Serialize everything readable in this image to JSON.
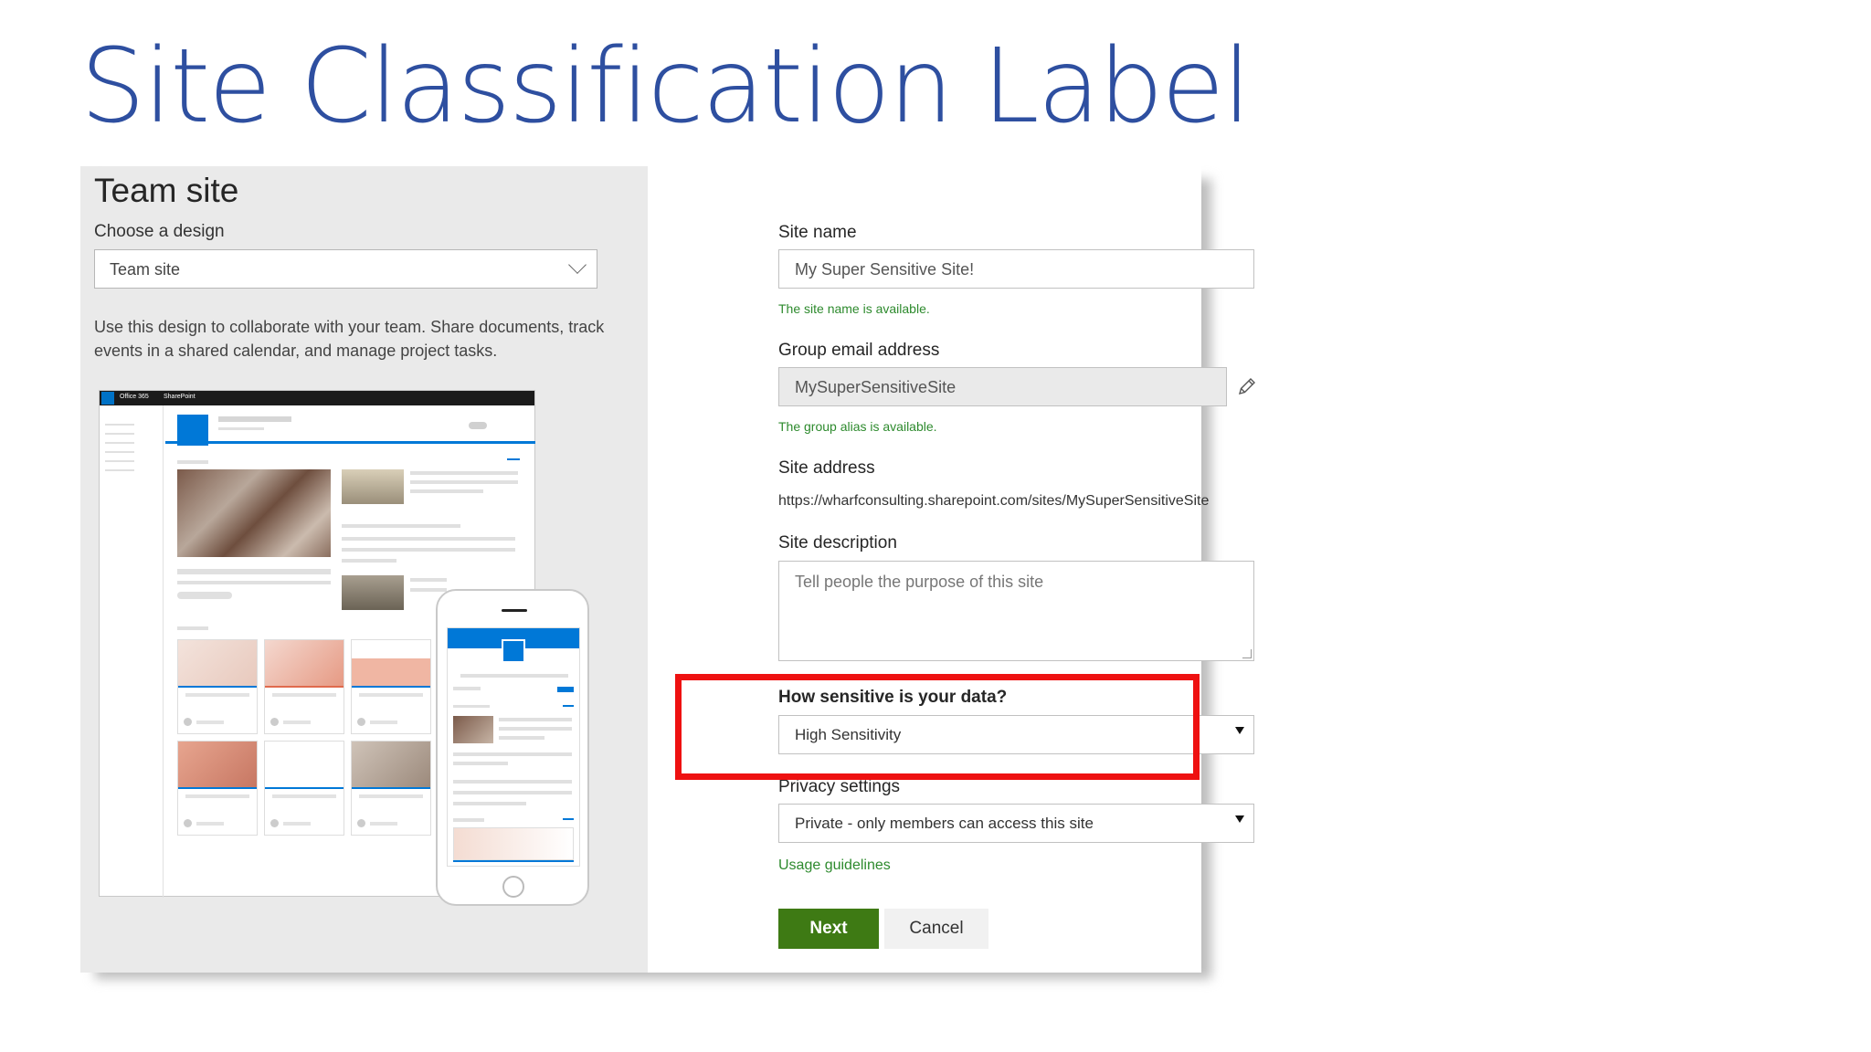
{
  "slide": {
    "title": "Site Classification Label"
  },
  "left_pane": {
    "title": "Team site",
    "design_label": "Choose a design",
    "design_value": "Team site",
    "description": "Use this design to collaborate with your team. Share documents, track events in a shared calendar, and manage project tasks.",
    "preview": {
      "bar_app": "Office 365",
      "bar_product": "SharePoint"
    }
  },
  "form": {
    "site_name_label": "Site name",
    "site_name_value": "My Super Sensitive Site!",
    "site_name_msg": "The site name is available.",
    "group_email_label": "Group email address",
    "group_email_value": "MySuperSensitiveSite",
    "group_email_msg": "The group alias is available.",
    "site_address_label": "Site address",
    "site_address_value": "https://wharfconsulting.sharepoint.com/sites/MySuperSensitiveSite",
    "site_description_label": "Site description",
    "site_description_placeholder": "Tell people the purpose of this site",
    "sensitivity_label": "How sensitive is your data?",
    "sensitivity_value": "High Sensitivity",
    "privacy_label": "Privacy settings",
    "privacy_value": "Private - only members can access this site",
    "usage_link": "Usage guidelines",
    "next_button": "Next",
    "cancel_button": "Cancel"
  },
  "colors": {
    "title": "#2e4fa0",
    "highlight": "#ee1111",
    "primary_button": "#3e7a14",
    "success_text": "#2d8a2d"
  },
  "icons": [
    "chevron-down-icon",
    "pencil-icon",
    "dropdown-caret-icon"
  ]
}
